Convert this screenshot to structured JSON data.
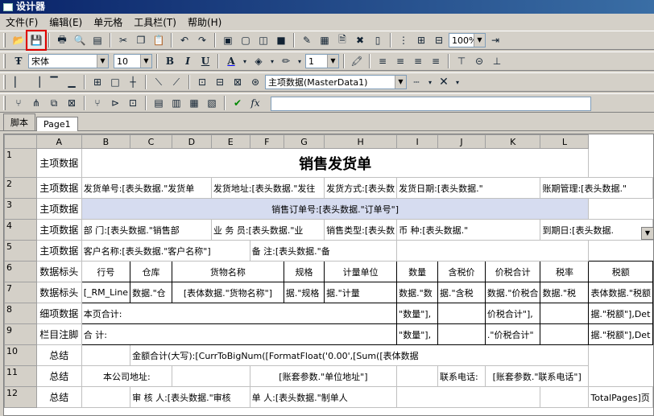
{
  "window": {
    "title": "设计器"
  },
  "menu": [
    "文件(F)",
    "编辑(E)",
    "单元格",
    "工具栏(T)",
    "帮助(H)"
  ],
  "toolbar1": {
    "zoom": "100%"
  },
  "toolbar2": {
    "font": "宋体",
    "size": "10",
    "line_width": "1"
  },
  "toolbar3": {
    "datasource": "主项数据(MasterData1)"
  },
  "tabs": [
    "脚本",
    "Page1"
  ],
  "columns": [
    "A",
    "B",
    "C",
    "D",
    "E",
    "F",
    "G",
    "H",
    "I",
    "J",
    "K",
    "L"
  ],
  "rows": {
    "r1": {
      "num": "1",
      "band": "主项数据",
      "title": "销售发货单"
    },
    "r2": {
      "num": "2",
      "band": "主项数据",
      "c1": "发货单号:[表头数据.\"发货单",
      "c2": "发货地址:[表头数据.\"发往",
      "c3": "发货方式:[表头数",
      "c4": "发货日期:[表头数据.\"",
      "c5": "账期管理:[表头数据.\""
    },
    "r3": {
      "num": "3",
      "band": "主项数据",
      "text": "销售订单号:[表头数据.\"订单号\"]"
    },
    "r4": {
      "num": "4",
      "band": "主项数据",
      "c1": "部  门:[表头数据.\"销售部",
      "c2": "业 务 员:[表头数据.\"业",
      "c3": "销售类型:[表头数",
      "c4": "币    种:[表头数据.\"",
      "c5": "到期日:[表头数据."
    },
    "r5": {
      "num": "5",
      "band": "主项数据",
      "c1": "客户名称:[表头数据.\"客户名称\"]",
      "c2": "备  注:[表头数据.\"备"
    },
    "r6": {
      "num": "6",
      "band": "数据标头",
      "h1": "行号",
      "h2": "仓库",
      "h3": "货物名称",
      "h4": "规格",
      "h5": "计量单位",
      "h6": "数量",
      "h7": "含税价",
      "h8": "价税合计",
      "h9": "税率",
      "h10": "税额"
    },
    "r7": {
      "num": "7",
      "band": "数据标头",
      "d1": "[_RM_Line",
      "d2": "数据.\"仓",
      "d3": "[表体数据.\"货物名称\"]",
      "d4": "据.\"规格",
      "d5": "据.\"计量",
      "d6": "数据.\"数",
      "d7": "据.\"含税",
      "d8": "数据.\"价税合",
      "d9": "数据.\"税",
      "d10": "表体数据.\"税额"
    },
    "r8": {
      "num": "8",
      "band": "细项数据",
      "c1": "本页合计:",
      "c2": "\"数量\"],",
      "c3": "价税合计\"],",
      "c4": "据.\"税额\"],Det"
    },
    "r9": {
      "num": "9",
      "band": "栏目注脚",
      "c1": "合   计:",
      "c2": "\"数量\"],",
      "c3": ".\"价税合计\"",
      "c4": "据.\"税额\"],Det"
    },
    "r10": {
      "num": "10",
      "band": "总结",
      "text": "金额合计(大写):[CurrToBigNum([FormatFloat('0.00',[Sum([表体数据"
    },
    "r11": {
      "num": "11",
      "band": "总结",
      "c1": "本公司地址:",
      "c2": "[账套参数.\"单位地址\"]",
      "c3": "联系电话:",
      "c4": "[账套参数.\"联系电话\"]"
    },
    "r12": {
      "num": "12",
      "band": "总结",
      "c1": "审 核 人:[表头数据.\"审核",
      "c2": "单 人:[表头数据.\"制单人",
      "c3": "TotalPages]页"
    }
  }
}
